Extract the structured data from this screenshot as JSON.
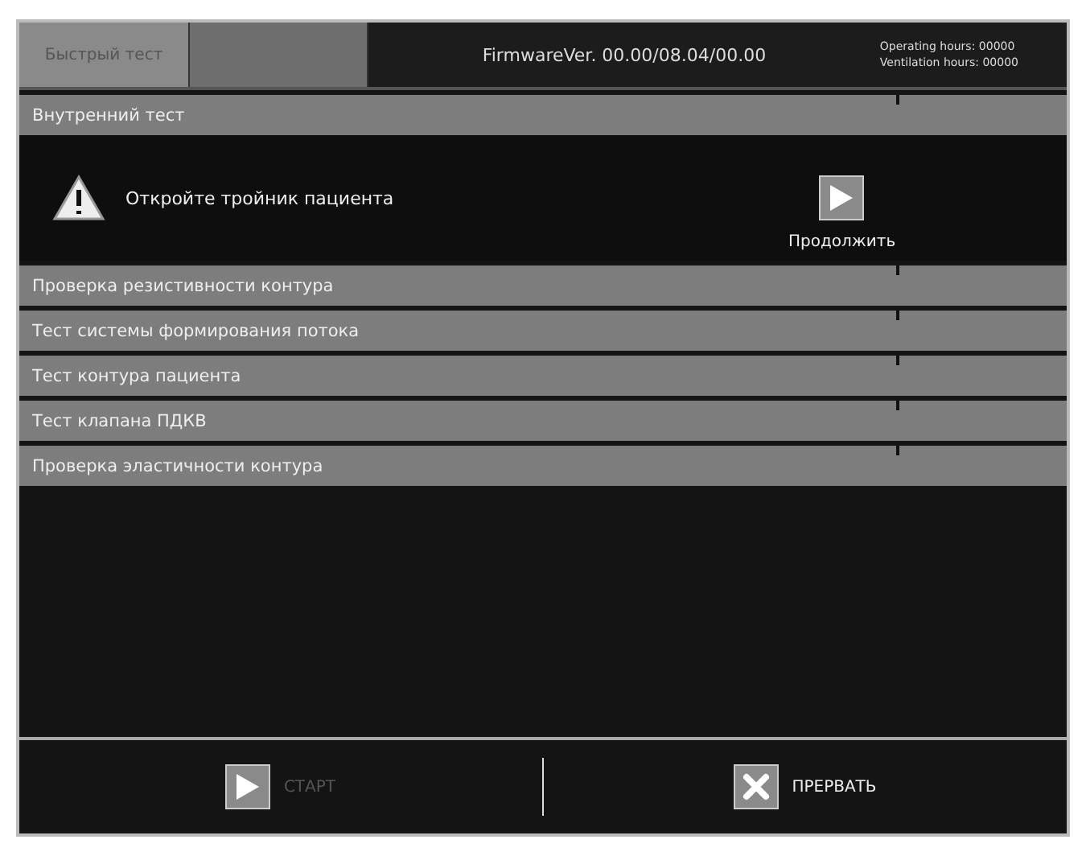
{
  "tabs": [
    {
      "label": "Быстрый тест",
      "selected": true
    },
    {
      "selected": false
    }
  ],
  "firmware": "FirmwareVer. 00.00/08.04/00.00",
  "hours": [
    "Operating hours: 00000",
    "Ventilation hours: 00000"
  ],
  "tests": [
    {
      "name": "Внутренний тест",
      "expanded": true,
      "message": "Откройте тройник пациента",
      "action": "Продолжить"
    },
    {
      "name": "Проверка резистивности контура",
      "expanded": false
    },
    {
      "name": "Тест системы формирования потока",
      "expanded": false
    },
    {
      "name": "Тест контура пациента",
      "expanded": false
    },
    {
      "name": "Тест клапана ПДКВ",
      "expanded": false
    },
    {
      "name": "Проверка эластичности контура",
      "expanded": false
    }
  ],
  "buttons": [
    {
      "kind": "start",
      "label": "СТАРТ",
      "disabled": true
    },
    {
      "kind": "abort",
      "label": "ПРЕРВАТЬ",
      "disabled": false
    }
  ]
}
